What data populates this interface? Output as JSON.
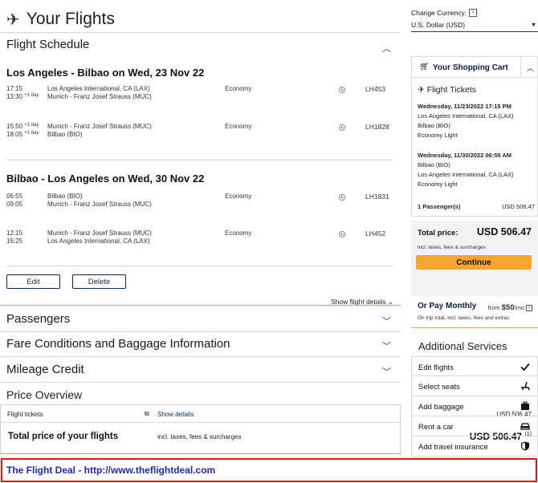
{
  "page": {
    "title": "Your Flights",
    "title_icon": "airplane-icon"
  },
  "schedule": {
    "heading": "Flight Schedule",
    "outbound": {
      "title": "Los Angeles - Bilbao on Wed, 23 Nov 22",
      "segments": [
        {
          "dep_time": "17:15",
          "arr_time": "13:30",
          "arr_day": "+1 day",
          "from": "Los Angeles International, CA (LAX)",
          "to": "Munich - Franz Josef Strauss (MUC)",
          "cabin": "Economy",
          "flight": "LH453"
        },
        {
          "dep_time": "15:50",
          "dep_day": "+1 day",
          "arr_time": "18:05",
          "arr_day": "+1 day",
          "from": "Munich - Franz Josef Strauss (MUC)",
          "to": "Bilbao (BIO)",
          "cabin": "Economy",
          "flight": "LH1828"
        }
      ]
    },
    "return": {
      "title": "Bilbao - Los Angeles on Wed, 30 Nov 22",
      "segments": [
        {
          "dep_time": "06:55",
          "arr_time": "09:05",
          "from": "Bilbao (BIO)",
          "to": "Munich - Franz Josef Strauss (MUC)",
          "cabin": "Economy",
          "flight": "LH1831"
        },
        {
          "dep_time": "12:15",
          "arr_time": "15:25",
          "from": "Munich - Franz Josef Strauss (MUC)",
          "to": "Los Angeles International, CA (LAX)",
          "cabin": "Economy",
          "flight": "LH452"
        }
      ]
    },
    "edit_label": "Edit",
    "delete_label": "Delete",
    "show_details_label": "Show flight details"
  },
  "sections": {
    "passengers": "Passengers",
    "fare": "Fare Conditions and Baggage Information",
    "mileage": "Mileage Credit"
  },
  "price_overview": {
    "title": "Price Overview",
    "tickets_label": "Flight tickets",
    "show_details": "Show details",
    "tickets_amount": "USD 506.47",
    "total_label": "Total price of your flights",
    "total_note": "incl. taxes, fees & surcharges",
    "total_amount": "USD 506.47",
    "total_footnote": "(1)"
  },
  "currency": {
    "label": "Change Currency:",
    "info": "i",
    "selected": "U.S. Dollar (USD)"
  },
  "cart": {
    "title": "Your Shopping Cart",
    "subtitle": "Flight Tickets",
    "outbound_date": "Wednesday, 11/23/2022 17:15 PM",
    "outbound_from": "Los Angeles International, CA (LAX)",
    "outbound_to": "Bilbao (BIO)",
    "outbound_fare": "Economy Light",
    "return_date": "Wednesday, 11/30/2022 06:55 AM",
    "return_from": "Bilbao (BIO)",
    "return_to": "Los Angeles International, CA (LAX)",
    "return_fare": "Economy Light",
    "passengers": "1 Passenger(s)",
    "passengers_amount": "USD 506.47"
  },
  "total_panel": {
    "label": "Total price:",
    "amount": "USD 506.47",
    "note": "incl. taxes, fees & surcharges",
    "continue_label": "Continue"
  },
  "pay_monthly": {
    "title": "Or Pay Monthly",
    "from_prefix": "from",
    "from_amount": "$50",
    "from_suffix": "/mo",
    "note": "On trip total, incl. taxes, fees and extras"
  },
  "additional_services": {
    "title": "Additional Services",
    "items": [
      {
        "label": "Edit flights",
        "icon": "checkmark-icon"
      },
      {
        "label": "Select seats",
        "icon": "seat-icon"
      },
      {
        "label": "Add baggage",
        "icon": "baggage-icon"
      },
      {
        "label": "Rent a car",
        "icon": "car-icon"
      },
      {
        "label": "Add travel insurance",
        "icon": "shield-icon"
      }
    ]
  },
  "footer": {
    "text": "The Flight Deal - http://www.theflightdeal.com"
  },
  "colors": {
    "accent": "#f6a530",
    "navy": "#0b1f44",
    "footer_border": "#e81010",
    "footer_text": "#1f2bb0"
  }
}
